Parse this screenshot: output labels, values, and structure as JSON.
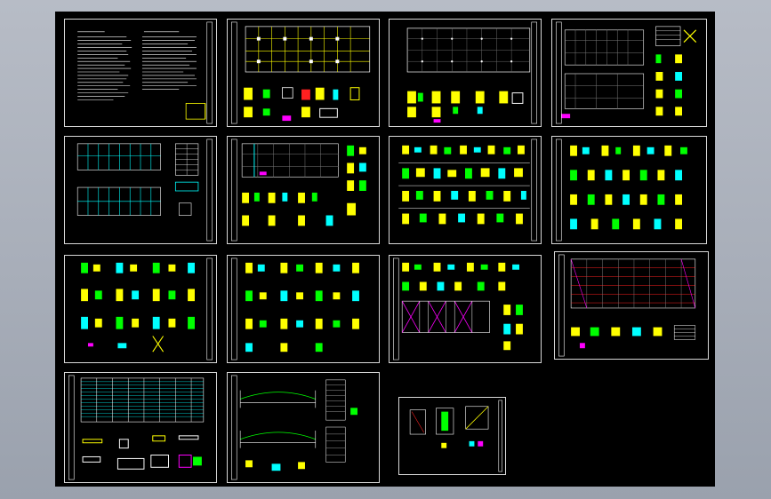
{
  "viewer": {
    "background": "#a9afba",
    "canvas_color": "#000000",
    "sheet_border": "#d8d8d8"
  },
  "colors": {
    "white": "#ffffff",
    "yellow": "#ffff00",
    "cyan": "#00ffff",
    "green": "#00ff00",
    "magenta": "#ff00ff",
    "red": "#ff2020",
    "blue": "#3030ff"
  },
  "sheets": [
    {
      "id": 1,
      "kind": "notes"
    },
    {
      "id": 2,
      "kind": "plan-with-details"
    },
    {
      "id": 3,
      "kind": "grid-plan-with-details"
    },
    {
      "id": 4,
      "kind": "grid-plan-with-tables"
    },
    {
      "id": 5,
      "kind": "elevations-with-table"
    },
    {
      "id": 6,
      "kind": "plan-with-nodes"
    },
    {
      "id": 7,
      "kind": "node-details"
    },
    {
      "id": 8,
      "kind": "node-details"
    },
    {
      "id": 9,
      "kind": "node-details"
    },
    {
      "id": 10,
      "kind": "node-details"
    },
    {
      "id": 11,
      "kind": "node-details-with-bracing"
    },
    {
      "id": 12,
      "kind": "roof-plan"
    },
    {
      "id": 13,
      "kind": "purlin-plan"
    },
    {
      "id": 14,
      "kind": "truss-elevation-with-tables"
    },
    {
      "id": 15,
      "kind": "small-detail"
    }
  ]
}
